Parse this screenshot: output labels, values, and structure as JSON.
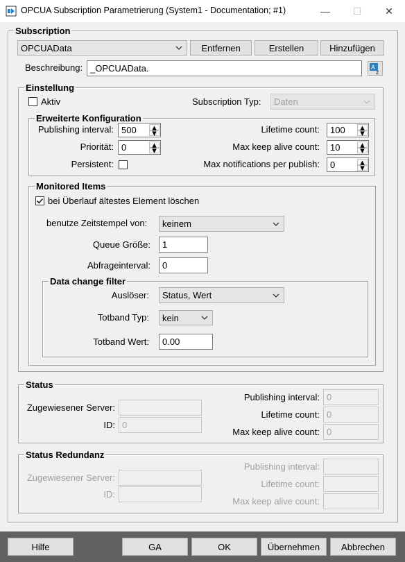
{
  "window": {
    "title": "OPCUA Subscription Parametrierung (System1 - Documentation; #1)",
    "minimize_glyph": "—",
    "maximize_glyph": "☐",
    "close_glyph": "✕"
  },
  "subscription": {
    "group_label": "Subscription",
    "selected": "OPCUAData",
    "remove_label": "Entfernen",
    "create_label": "Erstellen",
    "add_label": "Hinzufügen",
    "description_label": "Beschreibung:",
    "description_value": "_OPCUAData."
  },
  "einstellung": {
    "group_label": "Einstellung",
    "aktiv_label": "Aktiv",
    "aktiv_checked": false,
    "subscription_typ_label": "Subscription Typ:",
    "subscription_typ_value": "Daten"
  },
  "erweitert": {
    "group_label": "Erweiterte Konfiguration",
    "publishing_interval_label": "Publishing interval:",
    "publishing_interval_value": "500",
    "prioritaet_label": "Priorität:",
    "prioritaet_value": "0",
    "persistent_label": "Persistent:",
    "persistent_checked": false,
    "lifetime_count_label": "Lifetime count:",
    "lifetime_count_value": "100",
    "max_keep_alive_label": "Max keep alive count:",
    "max_keep_alive_value": "10",
    "max_notifications_label": "Max notifications per publish:",
    "max_notifications_value": "0"
  },
  "monitored": {
    "group_label": "Monitored Items",
    "overflow_label": "bei Überlauf ältestes Element löschen",
    "overflow_checked": true,
    "timestamp_label": "benutze Zeitstempel von:",
    "timestamp_value": "keinem",
    "queue_label": "Queue Größe:",
    "queue_value": "1",
    "abfrage_label": "Abfrageinterval:",
    "abfrage_value": "0"
  },
  "filter": {
    "group_label": "Data change filter",
    "ausloeser_label": "Auslöser:",
    "ausloeser_value": "Status, Wert",
    "totband_typ_label": "Totband Typ:",
    "totband_typ_value": "kein",
    "totband_wert_label": "Totband Wert:",
    "totband_wert_value": "0.00"
  },
  "status": {
    "group_label": "Status",
    "server_label": "Zugewiesener Server:",
    "server_value": "",
    "id_label": "ID:",
    "id_value": "0",
    "publishing_interval_label": "Publishing interval:",
    "publishing_interval_value": "0",
    "lifetime_count_label": "Lifetime count:",
    "lifetime_count_value": "0",
    "max_keep_alive_label": "Max keep alive count:",
    "max_keep_alive_value": "0"
  },
  "status_redundanz": {
    "group_label": "Status Redundanz",
    "server_label": "Zugewiesener Server:",
    "server_value": "",
    "id_label": "ID:",
    "id_value": "",
    "publishing_interval_label": "Publishing interval:",
    "publishing_interval_value": "",
    "lifetime_count_label": "Lifetime count:",
    "lifetime_count_value": "",
    "max_keep_alive_label": "Max keep alive count:",
    "max_keep_alive_value": ""
  },
  "footer": {
    "help_label": "Hilfe",
    "ga_label": "GA",
    "ok_label": "OK",
    "apply_label": "Übernehmen",
    "cancel_label": "Abbrechen"
  },
  "icons": {
    "app": "opcua-app-icon",
    "translate": "translate-icon",
    "dropdown": "chevron-down-icon",
    "checkbox_check": "check-icon"
  }
}
